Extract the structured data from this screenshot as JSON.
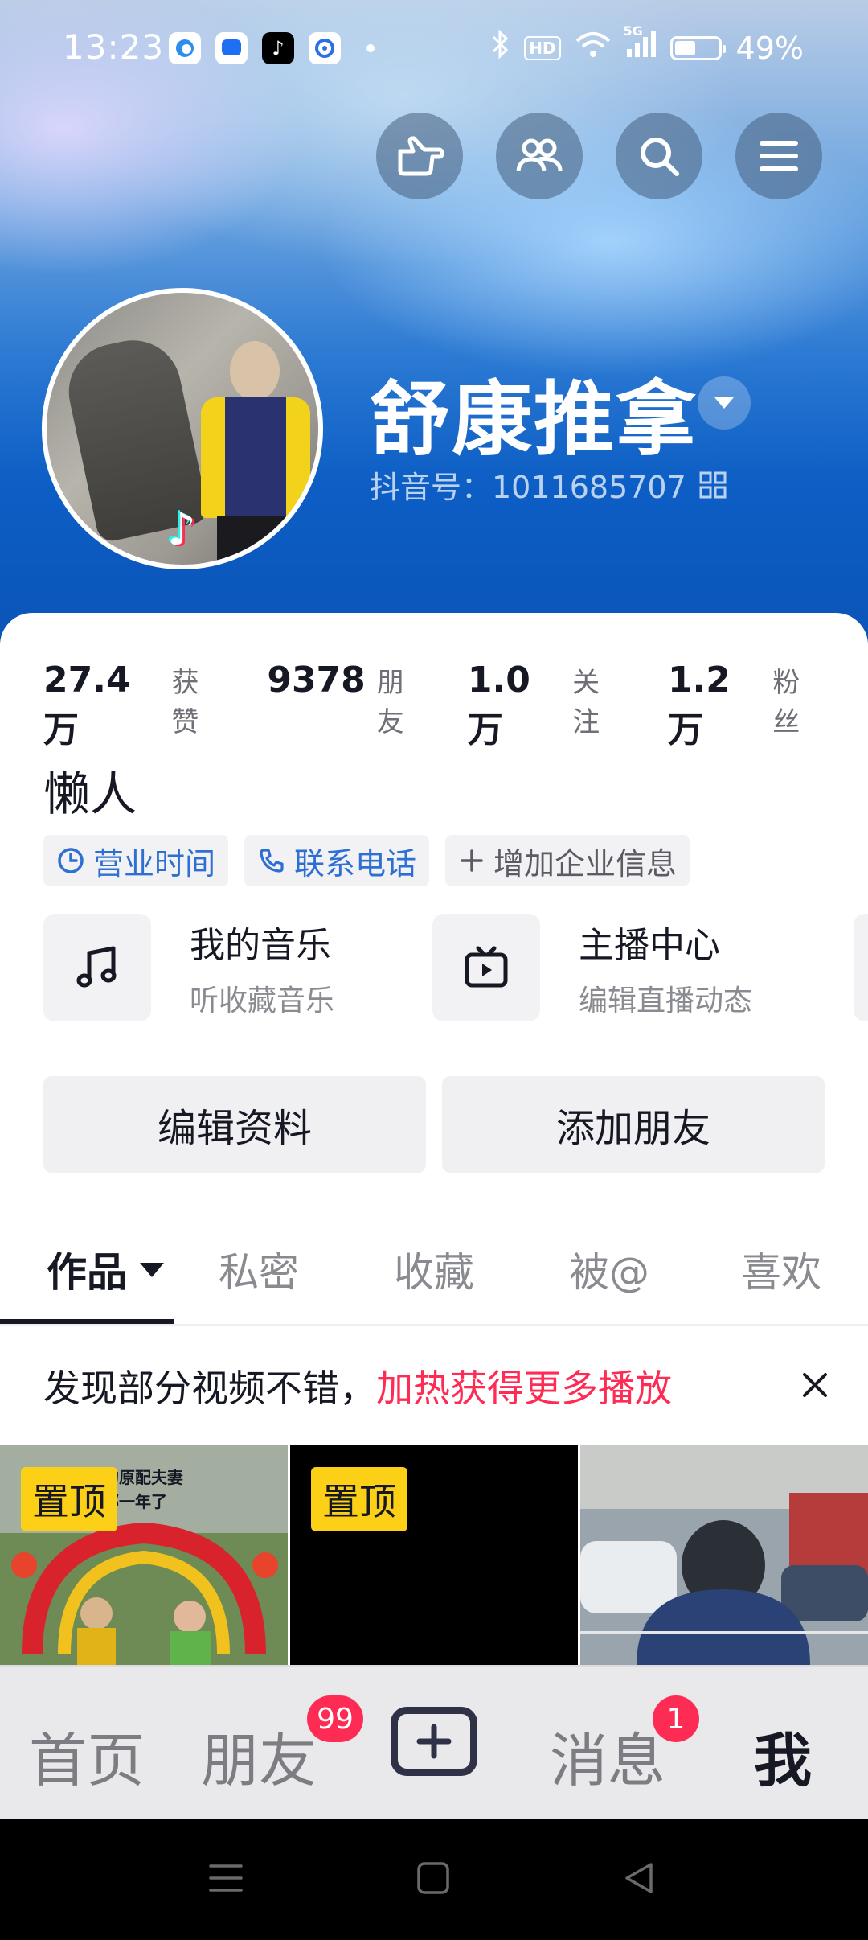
{
  "status_bar": {
    "time": "13:23",
    "battery_percent": "49%",
    "battery_level": 0.49,
    "network": "5G",
    "hd_label": "HD",
    "notification_icons": [
      "qq-browser-icon",
      "message-app-icon",
      "tiktok-icon",
      "search-app-icon"
    ]
  },
  "top_buttons": [
    "visitor-hand-icon",
    "friends-icon",
    "search-icon",
    "menu-icon"
  ],
  "profile": {
    "name": "舒康推拿",
    "douyin_id": "抖音号：1011685707",
    "bio": "懒人"
  },
  "stats": [
    {
      "value": "27.4万",
      "label": "获赞"
    },
    {
      "value": "9378",
      "label": "朋友"
    },
    {
      "value": "1.0万",
      "label": "关注"
    },
    {
      "value": "1.2万",
      "label": "粉丝"
    }
  ],
  "tags": [
    {
      "label": "营业时间",
      "icon": "clock-icon"
    },
    {
      "label": "联系电话",
      "icon": "phone-icon"
    },
    {
      "label": "增加企业信息",
      "icon": "plus-icon"
    }
  ],
  "services": [
    {
      "title": "我的音乐",
      "subtitle": "听收藏音乐",
      "icon": "music-note-icon"
    },
    {
      "title": "主播中心",
      "subtitle": "编辑直播动态",
      "icon": "tv-play-icon"
    }
  ],
  "actions": {
    "edit_profile": "编辑资料",
    "add_friends": "添加朋友"
  },
  "tabs": [
    {
      "label": "作品",
      "active": true
    },
    {
      "label": "私密",
      "active": false
    },
    {
      "label": "收藏",
      "active": false
    },
    {
      "label": "被@",
      "active": false
    },
    {
      "label": "喜欢",
      "active": false
    }
  ],
  "banner": {
    "text": "发现部分视频不错，",
    "highlight": "加热获得更多播放"
  },
  "videos": [
    {
      "pinned_label": "置顶",
      "caption": "上的原配夫妻\n到哪一年了"
    },
    {
      "pinned_label": "置顶",
      "caption": ""
    },
    {
      "pinned_label": "",
      "caption": ""
    }
  ],
  "bottom_nav": {
    "home": "首页",
    "friends": "朋友",
    "friends_badge": "99",
    "messages": "消息",
    "messages_badge": "1",
    "me": "我"
  },
  "colors": {
    "accent_red": "#fe2c55",
    "link_blue": "#2d6fd2",
    "pin_yellow": "#fcd017"
  }
}
